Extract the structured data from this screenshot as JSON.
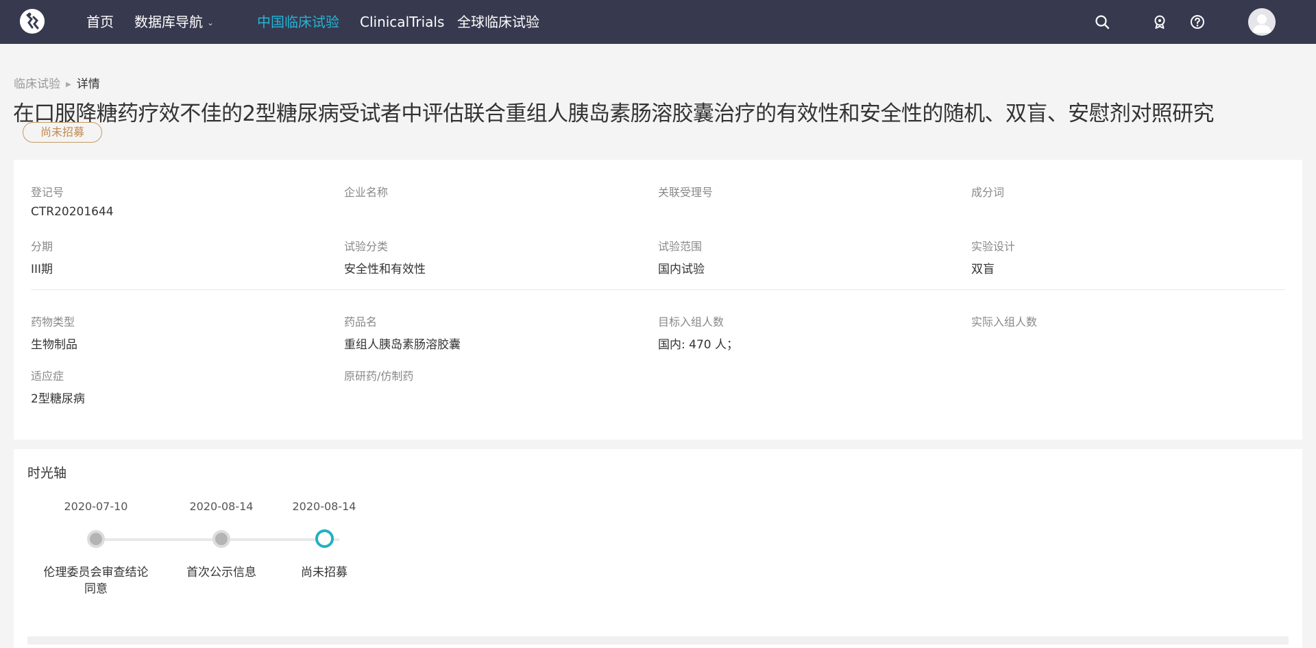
{
  "nav": {
    "home": "首页",
    "db_nav": "数据库导航",
    "cn_trials": "中国临床试验",
    "clinicaltrials": "ClinicalTrials",
    "global_trials": "全球临床试验"
  },
  "icons": {
    "search": "search-icon",
    "award": "award-icon",
    "help": "help-icon",
    "avatar": "user-icon",
    "db_nav_caret": "chevron-down-icon",
    "breadcrumb_sep": "triangle-right-icon"
  },
  "breadcrumb": {
    "parent": "临床试验",
    "current": "详情"
  },
  "title": "在口服降糖药疗效不佳的2型糖尿病受试者中评估联合重组人胰岛素肠溶胶囊治疗的有效性和安全性的随机、双盲、安慰剂对照研究",
  "status": "尚未招募",
  "info": {
    "reg_no": {
      "label": "登记号",
      "value": "CTR20201644"
    },
    "company": {
      "label": "企业名称",
      "value": ""
    },
    "accept_no": {
      "label": "关联受理号",
      "value": ""
    },
    "ingredient": {
      "label": "成分词",
      "value": ""
    },
    "phase": {
      "label": "分期",
      "value": "III期"
    },
    "category": {
      "label": "试验分类",
      "value": "安全性和有效性"
    },
    "scope": {
      "label": "试验范围",
      "value": "国内试验"
    },
    "design": {
      "label": "实验设计",
      "value": "双盲"
    },
    "drug_type": {
      "label": "药物类型",
      "value": "生物制品"
    },
    "drug_name": {
      "label": "药品名",
      "value": "重组人胰岛素肠溶胶囊"
    },
    "target_enroll": {
      "label": "目标入组人数",
      "value": "国内: 470 人；"
    },
    "actual_enroll": {
      "label": "实际入组人数",
      "value": ""
    },
    "indication": {
      "label": "适应症",
      "value": "2型糖尿病"
    },
    "original_generic": {
      "label": "原研药/仿制药",
      "value": ""
    }
  },
  "timeline": {
    "title": "时光轴",
    "events": [
      {
        "date": "2020-07-10",
        "label": "伦理委员会审查结论同意"
      },
      {
        "date": "2020-08-14",
        "label": "首次公示信息"
      },
      {
        "date": "2020-08-14",
        "label": "尚未招募"
      }
    ]
  },
  "colors": {
    "nav_bg": "#373a4f",
    "nav_active": "#26b3d6",
    "status_border": "#c59a66",
    "timeline_current": "#22b0c4"
  }
}
